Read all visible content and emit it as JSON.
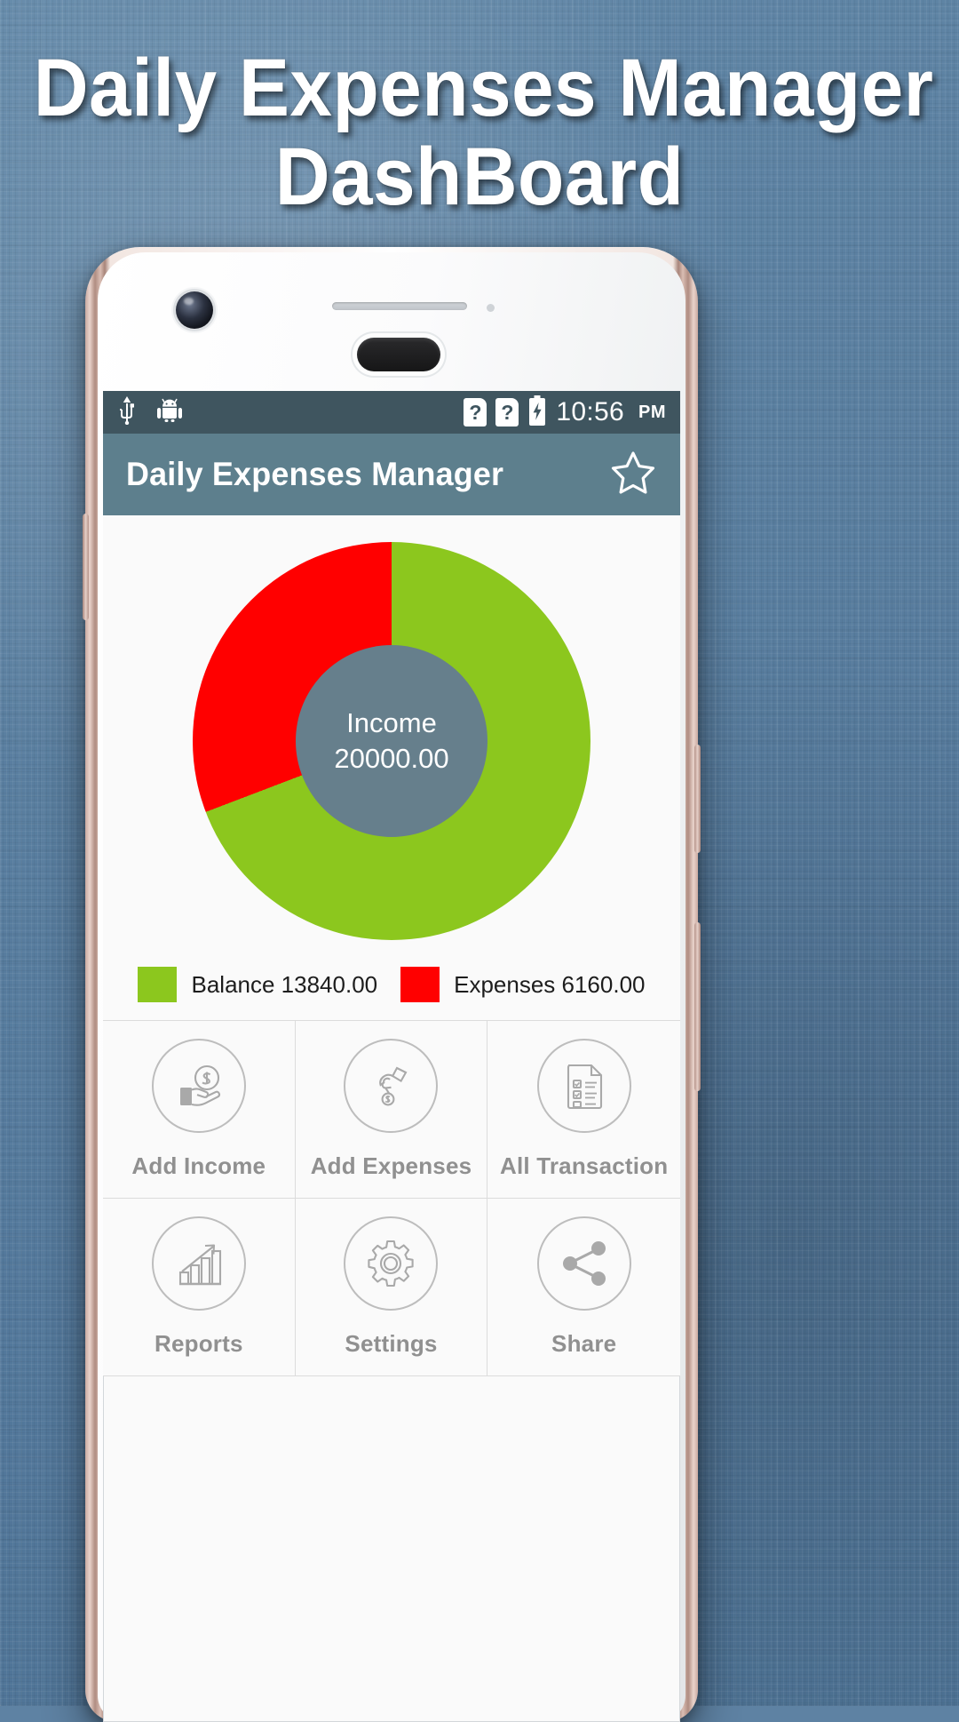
{
  "promo": {
    "line1": "Daily Expenses Manager",
    "line2": "DashBoard"
  },
  "phone": {
    "statusbar": {
      "usb_icon": "usb-icon",
      "android_icon": "android-robot-icon",
      "sim1": "?",
      "sim2": "?",
      "battery_icon": "battery-charging-icon",
      "time": "10:56",
      "ampm": "PM",
      "background": "#3f555f"
    },
    "appbar": {
      "title": "Daily Expenses Manager",
      "star_icon": "star-outline-icon",
      "background": "#5d7f8d"
    }
  },
  "chart_data": {
    "type": "pie",
    "title": "Income 20000.00",
    "center_label": "Income",
    "center_value": "20000.00",
    "categories": [
      "Balance",
      "Expenses"
    ],
    "values": [
      13840.0,
      6160.0
    ],
    "total": 20000.0,
    "colors": [
      "#8cc71e",
      "#ff0000"
    ],
    "hole_color": "#667f8c",
    "legend_position": "bottom",
    "grid": false,
    "legend": [
      {
        "label": "Balance",
        "value": "13840.00",
        "color": "#8cc71e"
      },
      {
        "label": "Expenses",
        "value": "6160.00",
        "color": "#ff0000"
      }
    ]
  },
  "grid": {
    "items": [
      {
        "label": "Add Income",
        "icon": "hand-holding-coin-icon"
      },
      {
        "label": "Add Expenses",
        "icon": "hand-dropping-coin-icon"
      },
      {
        "label": "All Transaction",
        "icon": "checklist-document-icon"
      },
      {
        "label": "Reports",
        "icon": "bar-chart-growth-icon"
      },
      {
        "label": "Settings",
        "icon": "gear-icon"
      },
      {
        "label": "Share",
        "icon": "share-nodes-icon"
      }
    ]
  }
}
